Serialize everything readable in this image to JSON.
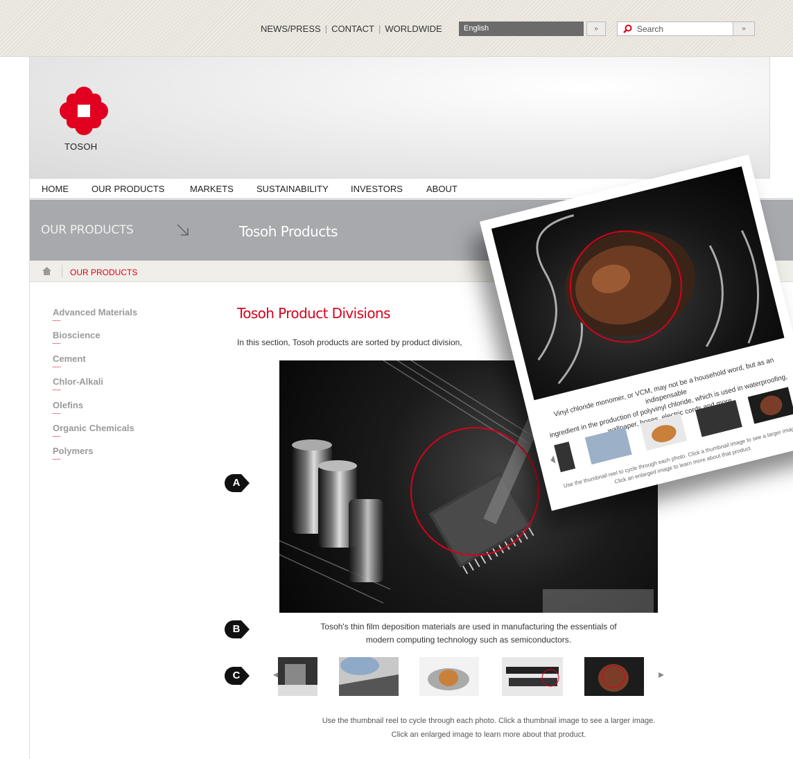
{
  "utility": {
    "links": [
      "NEWS/PRESS",
      "CONTACT",
      "WORLDWIDE"
    ],
    "language": "English",
    "search_placeholder": "Search"
  },
  "brand": {
    "logo_text": "TOSOH",
    "color": "#d9001b"
  },
  "nav": [
    "HOME",
    "OUR PRODUCTS",
    "MARKETS",
    "SUSTAINABILITY",
    "INVESTORS",
    "ABOUT"
  ],
  "section": {
    "name": "OUR PRODUCTS",
    "heading": "Tosoh Products"
  },
  "breadcrumb": {
    "current": "OUR PRODUCTS"
  },
  "sidebar": [
    "Advanced Materials",
    "Bioscience",
    "Cement",
    "Chlor-Alkali",
    "Olefins",
    "Organic Chemicals",
    "Polymers"
  ],
  "content": {
    "title": "Tosoh Product Divisions",
    "intro": "In this section, Tosoh products are sorted by product division,",
    "caption_line1": "Tosoh's thin film deposition materials are used in manufacturing the essentials of",
    "caption_line2": "modern computing technology such as semiconductors.",
    "instructions_line1": "Use the thumbnail reel to cycle through each photo. Click a thumbnail image to see a larger image.",
    "instructions_line2": "Click an enlarged image to learn more about that product."
  },
  "markers": [
    "A",
    "B",
    "C"
  ],
  "inset": {
    "text_line1": "Vinyl chloride monomer, or VCM, may not be a household word, but as an indispensable",
    "text_line2": "ingredient in the production of polyvinyl chloride, which is used in waterproofing,",
    "text_line3": "wallpaper, hoses, electric cords and more.",
    "small_line1": "Use the thumbnail reel to cycle through each photo. Click a thumbnail image to see a larger image.",
    "small_line2": "Click an enlarged image to learn more about that product."
  },
  "icons": {
    "search": "search-icon",
    "home": "home-icon",
    "section_arrow": "arrow-down-right-icon",
    "reel_prev": "chevron-left-icon",
    "reel_next": "chevron-right-icon"
  }
}
